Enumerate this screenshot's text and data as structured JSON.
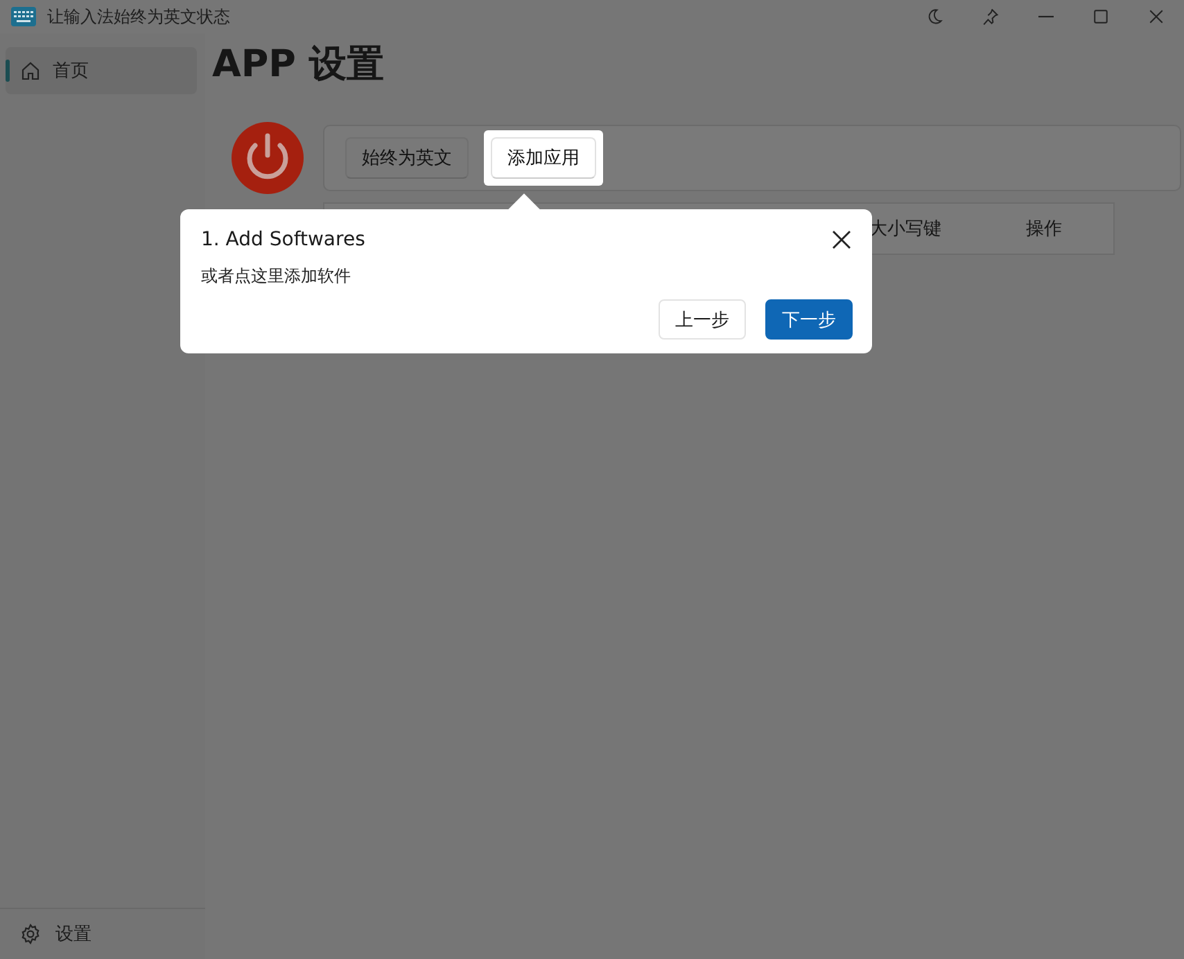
{
  "window": {
    "title": "让输入法始终为英文状态"
  },
  "sidebar": {
    "items": [
      {
        "label": "首页",
        "kind": "home",
        "selected": true
      }
    ],
    "footer": {
      "label": "设置",
      "kind": "gear"
    }
  },
  "page": {
    "heading": "APP 设置",
    "power_on": true,
    "toolbar": [
      {
        "label": "始终为英文",
        "highlighted": false
      },
      {
        "label": "添加应用",
        "highlighted": true
      }
    ],
    "table": {
      "columns": [
        "大小写键",
        "操作"
      ]
    }
  },
  "tour": {
    "title": "1. Add Softwares",
    "description": "或者点这里添加软件",
    "buttons": [
      {
        "label": "上一步",
        "primary": false
      },
      {
        "label": "下一步",
        "primary": true
      }
    ]
  }
}
